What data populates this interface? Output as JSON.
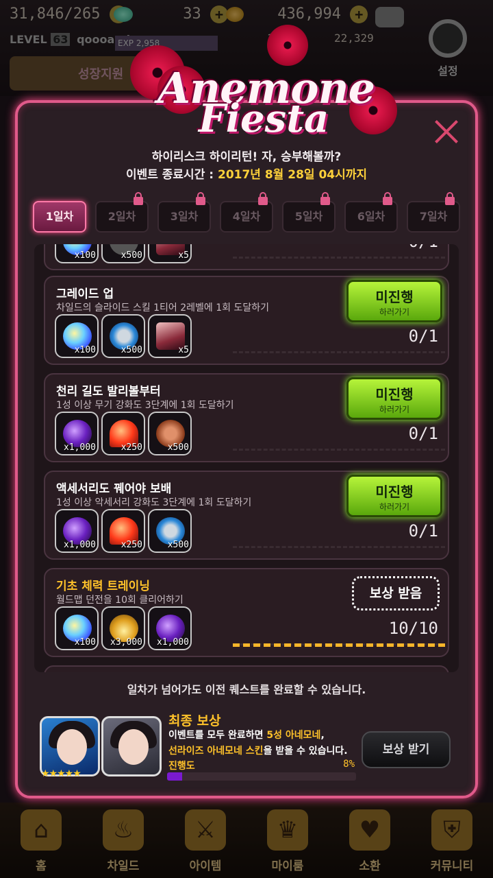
{
  "hud": {
    "stamina": "31,846/265",
    "gems": "33",
    "gold": "436,994",
    "level_label": "LEVEL",
    "level": "63",
    "player_name": "qoooarcher",
    "exp_label": "EXP 2,958",
    "extra_1": "14",
    "extra_2": "22,329",
    "banner_text": "성장지원",
    "settings_label": "설정"
  },
  "event": {
    "logo_line1": "Anemone",
    "logo_line2": "Fiesta",
    "subtitle": "하이리스크 하이리턴! 자, 승부해볼까?",
    "time_label": "이벤트 종료시간 : ",
    "time_value": "2017년 8월 28일 04시까지"
  },
  "tabs": [
    {
      "label": "1일차",
      "active": true,
      "locked": false
    },
    {
      "label": "2일차",
      "active": false,
      "locked": true
    },
    {
      "label": "3일차",
      "active": false,
      "locked": true
    },
    {
      "label": "4일차",
      "active": false,
      "locked": true
    },
    {
      "label": "5일차",
      "active": false,
      "locked": true
    },
    {
      "label": "6일차",
      "active": false,
      "locked": true
    },
    {
      "label": "7일차",
      "active": false,
      "locked": true
    }
  ],
  "quests": [
    {
      "title": "",
      "desc": "",
      "rewards": [
        {
          "icon": "gem-icon",
          "qty": "x100"
        },
        {
          "icon": "gold-icon",
          "qty": "x500"
        },
        {
          "icon": "crystal-icon",
          "qty": "x5"
        }
      ],
      "progress": "0/1",
      "progress_fraction": 0,
      "status": "partial"
    },
    {
      "title": "그레이드 업",
      "desc": "차일드의 슬라이드 스킬 1티어 2레벨에 1회 도달하기",
      "rewards": [
        {
          "icon": "gem-icon",
          "qty": "x100"
        },
        {
          "icon": "weapon-orb-icon",
          "qty": "x500"
        },
        {
          "icon": "crystal-icon",
          "qty": "x5"
        }
      ],
      "progress": "0/1",
      "progress_fraction": 0,
      "status": "incomplete"
    },
    {
      "title": "천리 길도 발리볼부터",
      "desc": "1성 이상 무기 강화도 3단계에 1회 도달하기",
      "rewards": [
        {
          "icon": "purple-gem-icon",
          "qty": "x1,000"
        },
        {
          "icon": "heart-icon",
          "qty": "x250"
        },
        {
          "icon": "coin-icon",
          "qty": "x500"
        }
      ],
      "progress": "0/1",
      "progress_fraction": 0,
      "status": "incomplete"
    },
    {
      "title": "액세서리도 꿰어야 보배",
      "desc": "1성 이상 악세서리 강화도 3단계에 1회 도달하기",
      "rewards": [
        {
          "icon": "purple-gem-icon",
          "qty": "x1,000"
        },
        {
          "icon": "heart-icon",
          "qty": "x250"
        },
        {
          "icon": "weapon-orb-icon",
          "qty": "x500"
        }
      ],
      "progress": "0/1",
      "progress_fraction": 0,
      "status": "incomplete"
    },
    {
      "title": "기초 체력 트레이닝",
      "desc": "월드맵 던전을 10회 클리어하기",
      "rewards": [
        {
          "icon": "gem-icon",
          "qty": "x100"
        },
        {
          "icon": "gold-pile-icon",
          "qty": "x3,000"
        },
        {
          "icon": "purple-gem-icon",
          "qty": "x1,000"
        }
      ],
      "progress": "10/10",
      "progress_fraction": 1,
      "status": "claimed"
    }
  ],
  "buttons": {
    "go_line1": "미진행",
    "go_line2": "하러가기",
    "claimed": "보상 받음"
  },
  "notice": "일차가 넘어가도 이전 퀘스트를 완료할 수 있습니다.",
  "final_reward": {
    "title": "최종 보상",
    "desc_a": "이벤트를 모두 완료하면 ",
    "desc_b": "5성 아네모네",
    "desc_c": ",",
    "desc_d": "선라이즈 아네모네 스킨",
    "desc_e": "을 받을 수 있습니다.",
    "progress_label": "진행도",
    "progress_pct": "8%",
    "progress_value": 0.08,
    "stars": "★★★★★",
    "button": "보상 받기"
  },
  "nav": [
    {
      "label": "홈",
      "icon": "home-icon",
      "glyph": "⌂"
    },
    {
      "label": "차일드",
      "icon": "child-icon",
      "glyph": "♨"
    },
    {
      "label": "아이템",
      "icon": "item-icon",
      "glyph": "⚔"
    },
    {
      "label": "마이룸",
      "icon": "myroom-icon",
      "glyph": "♛"
    },
    {
      "label": "소환",
      "icon": "summon-icon",
      "glyph": "♥"
    },
    {
      "label": "커뮤니티",
      "icon": "community-icon",
      "glyph": "⛨"
    }
  ],
  "colors": {
    "accent_pink": "#e05a8a",
    "go_green": "#8eff30",
    "highlight_gold": "#ffc22a",
    "progress_purple": "#7a1ad0"
  }
}
